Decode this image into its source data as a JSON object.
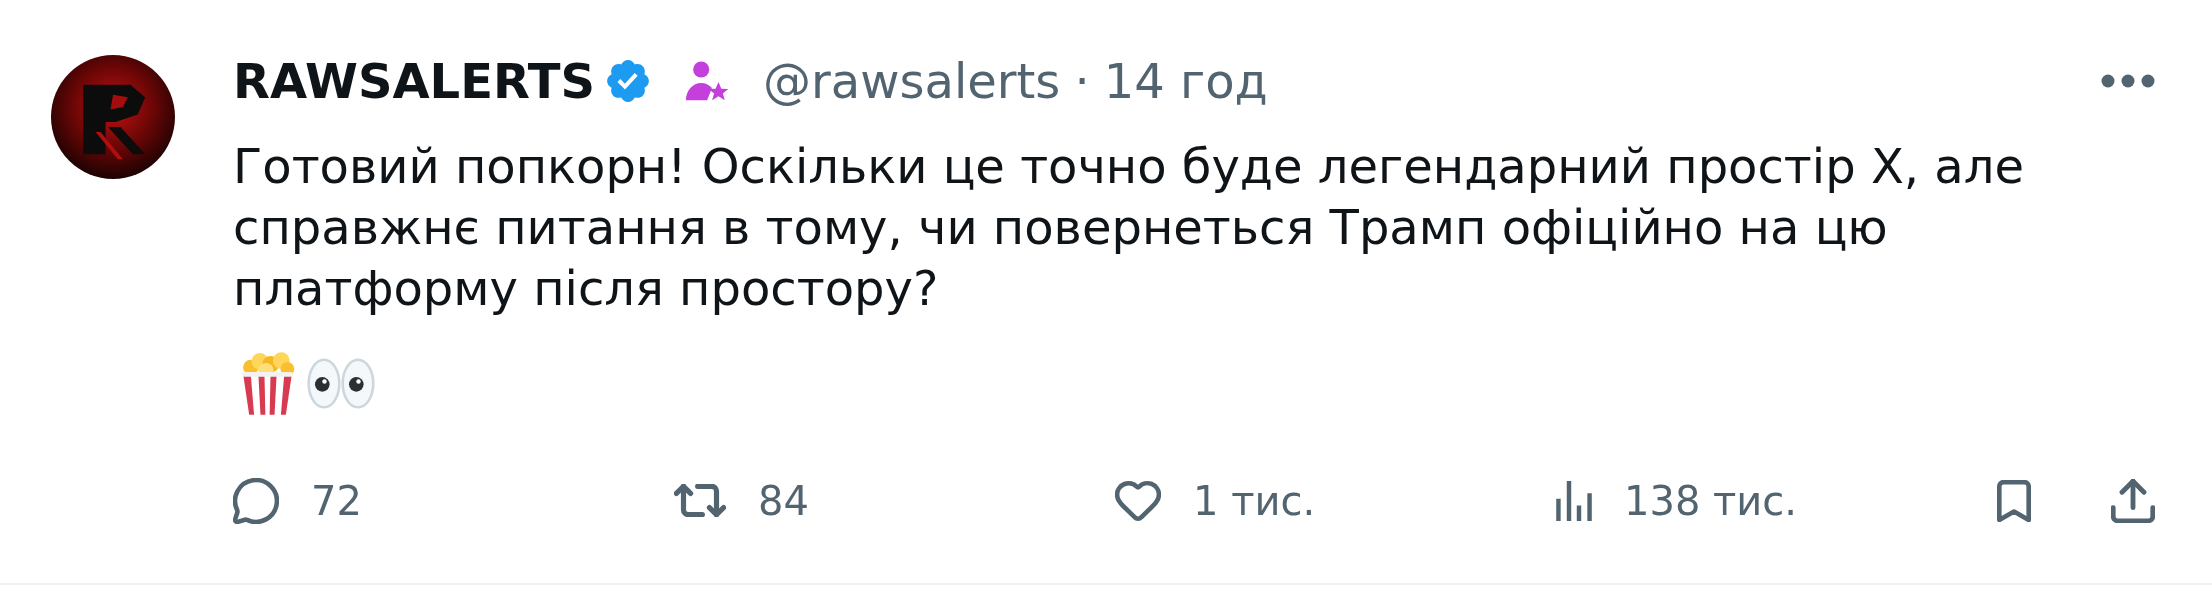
{
  "post": {
    "author": {
      "name": "RAWSALERTS",
      "handle": "@rawsalerts",
      "separator": "·",
      "time": "14 год"
    },
    "text": "Готовий попкорн! Оскільки це точно буде легендарний простір X, але справжнє питання в тому, чи повернеться Трамп офіційно на цю платформу після простору?",
    "actions": [
      {
        "kind": "reply",
        "count": "72"
      },
      {
        "kind": "repost",
        "count": "84"
      },
      {
        "kind": "like",
        "count": "1 тис."
      },
      {
        "kind": "views",
        "count": "138 тис."
      }
    ],
    "side_actions": [
      {
        "kind": "bookmark"
      },
      {
        "kind": "share"
      }
    ]
  }
}
